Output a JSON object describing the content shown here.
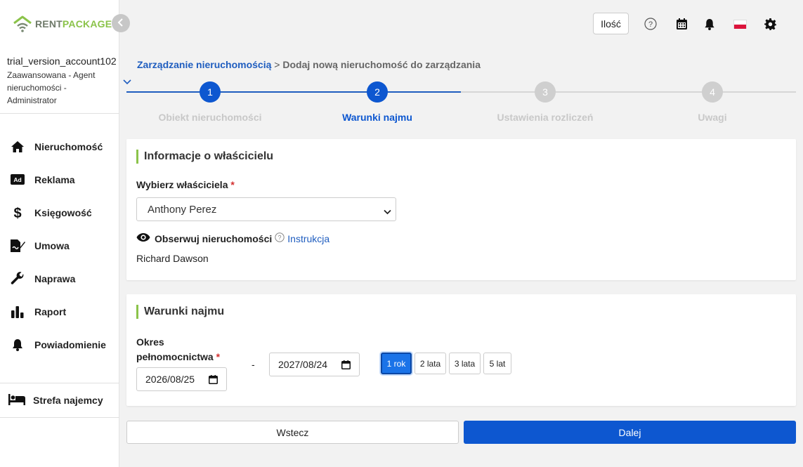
{
  "brand": {
    "name_part1": "RENT",
    "name_part2": "PACKAGE"
  },
  "account": {
    "name": "trial_version_account102",
    "role": "Zaawansowana - Agent nieruchomości - Administrator"
  },
  "sidebar": {
    "items": [
      {
        "label": "Nieruchomość",
        "icon": "home-icon"
      },
      {
        "label": "Reklama",
        "icon": "ad-icon"
      },
      {
        "label": "Księgowość",
        "icon": "dollar-icon"
      },
      {
        "label": "Umowa",
        "icon": "contract-icon"
      },
      {
        "label": "Naprawa",
        "icon": "wrench-icon"
      },
      {
        "label": "Raport",
        "icon": "bar-chart-icon"
      },
      {
        "label": "Powiadomienie",
        "icon": "bell-icon"
      }
    ],
    "tenant_zone": {
      "label": "Strefa najemcy",
      "icon": "bed-icon"
    }
  },
  "topbar": {
    "qty_button": "Ilość",
    "icons": [
      "help-icon",
      "calendar-icon",
      "bell-icon",
      "poland-flag-icon",
      "gear-icon"
    ]
  },
  "breadcrumb": {
    "parent": "Zarządzanie nieruchomością",
    "separator": ">",
    "current": "Dodaj nową nieruchomość do zarządzania"
  },
  "stepper": {
    "current_step": 2,
    "steps": [
      {
        "number": "1",
        "label": "Obiekt nieruchomości"
      },
      {
        "number": "2",
        "label": "Warunki najmu"
      },
      {
        "number": "3",
        "label": "Ustawienia rozliczeń"
      },
      {
        "number": "4",
        "label": "Uwagi"
      }
    ]
  },
  "owner_card": {
    "title": "Informacje o właścicielu",
    "select_label": "Wybierz właściciela",
    "required_mark": "*",
    "selected_owner": "Anthony Perez",
    "observe_label": "Obserwuj nieruchomości",
    "instruction_link": "Instrukcja",
    "observer_name": "Richard Dawson"
  },
  "terms_card": {
    "title": "Warunki najmu",
    "period_label_line1": "Okres",
    "period_label_line2": "pełnomocnictwa",
    "required_mark": "*",
    "start_date": "2026/08/25",
    "separator": "-",
    "end_date": "2027/08/24",
    "duration_options": [
      "1 rok",
      "2 lata",
      "3 lata",
      "5 lat"
    ],
    "selected_duration": "1 rok"
  },
  "actions": {
    "back": "Wstecz",
    "next": "Dalej"
  },
  "colors": {
    "primary": "#0d57d0",
    "accent_green": "#8bc34a",
    "step_inactive": "#cfcfcf",
    "link": "#1f5dbf"
  }
}
